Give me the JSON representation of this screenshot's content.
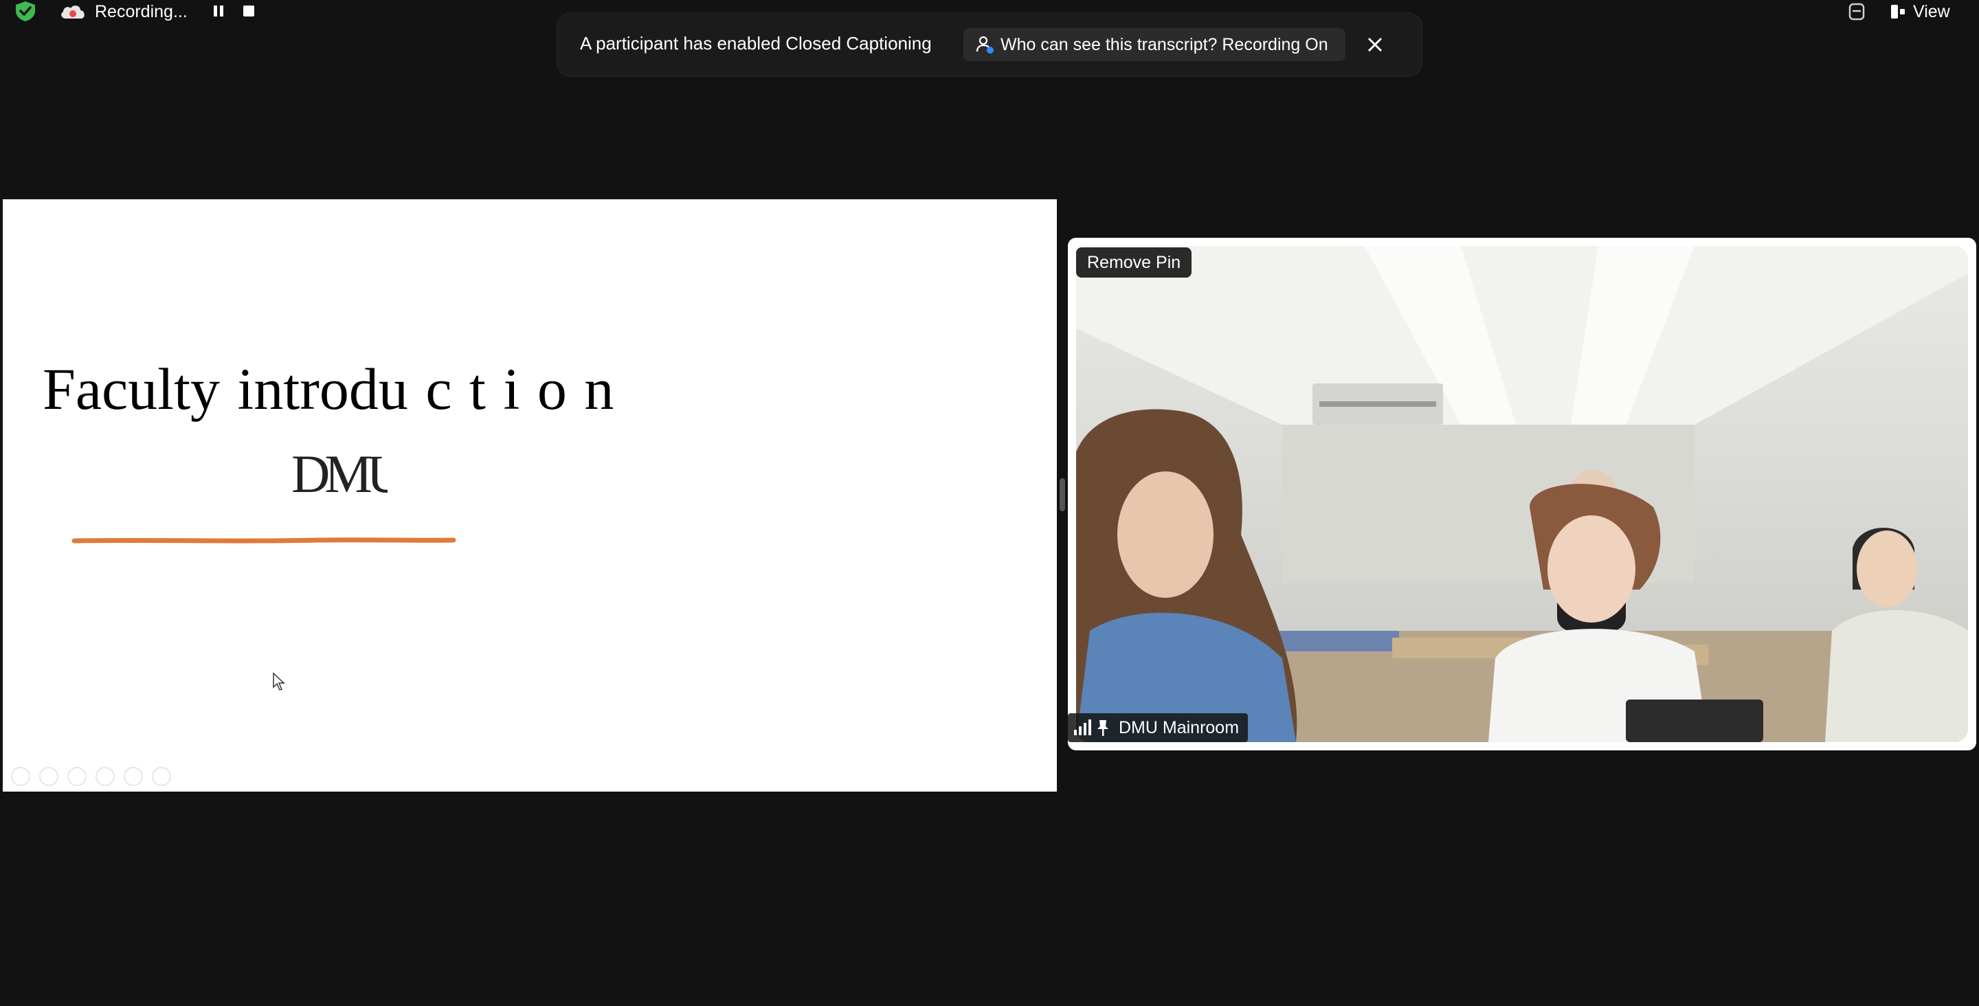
{
  "topbar": {
    "recording_label": "Recording...",
    "view_label": "View",
    "icons": [
      "security-shield-icon",
      "cloud-recording-icon",
      "pause-icon",
      "stop-icon",
      "transcript-stack-icon",
      "view-layout-icon"
    ]
  },
  "banner": {
    "message": "A participant has enabled Closed Captioning",
    "transcript_button_label": "Who can see this transcript? Recording On",
    "icons": [
      "person-icon",
      "close-icon"
    ]
  },
  "slide": {
    "title": "Faculty introdu c t i o n",
    "logo_text": "DMU",
    "toolbar_icons": [
      "previous-icon",
      "next-icon",
      "pen-icon",
      "copy-icon",
      "zoom-icon",
      "more-icon"
    ]
  },
  "video": {
    "tooltip_label": "Remove Pin",
    "participant_name": "DMU Mainroom",
    "icons": [
      "signal-icon",
      "pin-icon"
    ]
  },
  "colors": {
    "background": "#121212",
    "banner": "#1b1b1b",
    "button": "#2b2b2b",
    "shield_green": "#3fb950",
    "recording_red": "#e5484d",
    "accent_blue": "#2d8cff",
    "slide_underline": "#e07a3a"
  }
}
